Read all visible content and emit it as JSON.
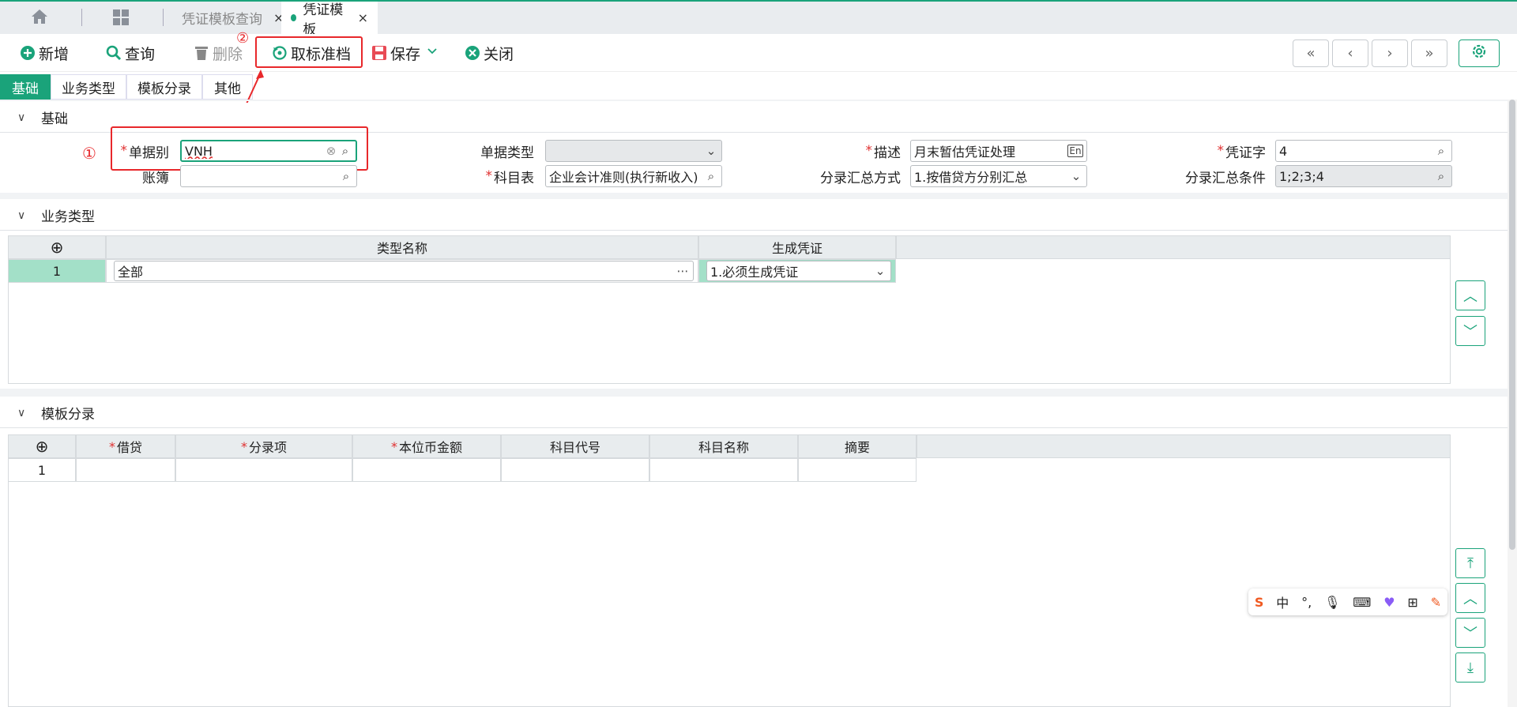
{
  "tabs": {
    "home_icon": "home-icon",
    "apps_icon": "grid-icon",
    "items": [
      {
        "label": "凭证模板查询",
        "close": "×"
      },
      {
        "label": "凭证模板",
        "close": "×"
      }
    ]
  },
  "toolbar": {
    "new": "新增",
    "query": "查询",
    "delete": "删除",
    "cancel_archive": "取标准档",
    "save": "保存",
    "close": "关闭",
    "annotation_2": "②"
  },
  "subtabs": [
    "基础",
    "业务类型",
    "模板分录",
    "其他"
  ],
  "basic": {
    "title": "基础",
    "annotation_1": "①",
    "doc_category_label": "单据别",
    "doc_category_value": "VNH",
    "doc_type_label": "单据类型",
    "doc_type_value": "",
    "desc_label": "描述",
    "desc_value": "月末暂估凭证处理",
    "voucher_word_label": "凭证字",
    "voucher_word_value": "4",
    "ledger_label": "账簿",
    "ledger_value": "",
    "account_table_label": "科目表",
    "account_table_value": "企业会计准则(执行新收入)",
    "summary_method_label": "分录汇总方式",
    "summary_method_value": "1.按借贷方分别汇总",
    "summary_cond_label": "分录汇总条件",
    "summary_cond_value": "1;2;3;4"
  },
  "biz_type": {
    "title": "业务类型",
    "columns": [
      "类型名称",
      "生成凭证"
    ],
    "rows": [
      {
        "no": "1",
        "name": "全部",
        "gen": "1.必须生成凭证"
      }
    ]
  },
  "template_entries": {
    "title": "模板分录",
    "columns": [
      "借贷",
      "分录项",
      "本位币金额",
      "科目代号",
      "科目名称",
      "摘要"
    ],
    "required": [
      true,
      true,
      true,
      false,
      false,
      false
    ],
    "rows": [
      {
        "no": "1"
      }
    ]
  },
  "ime": {
    "cn": "中"
  }
}
